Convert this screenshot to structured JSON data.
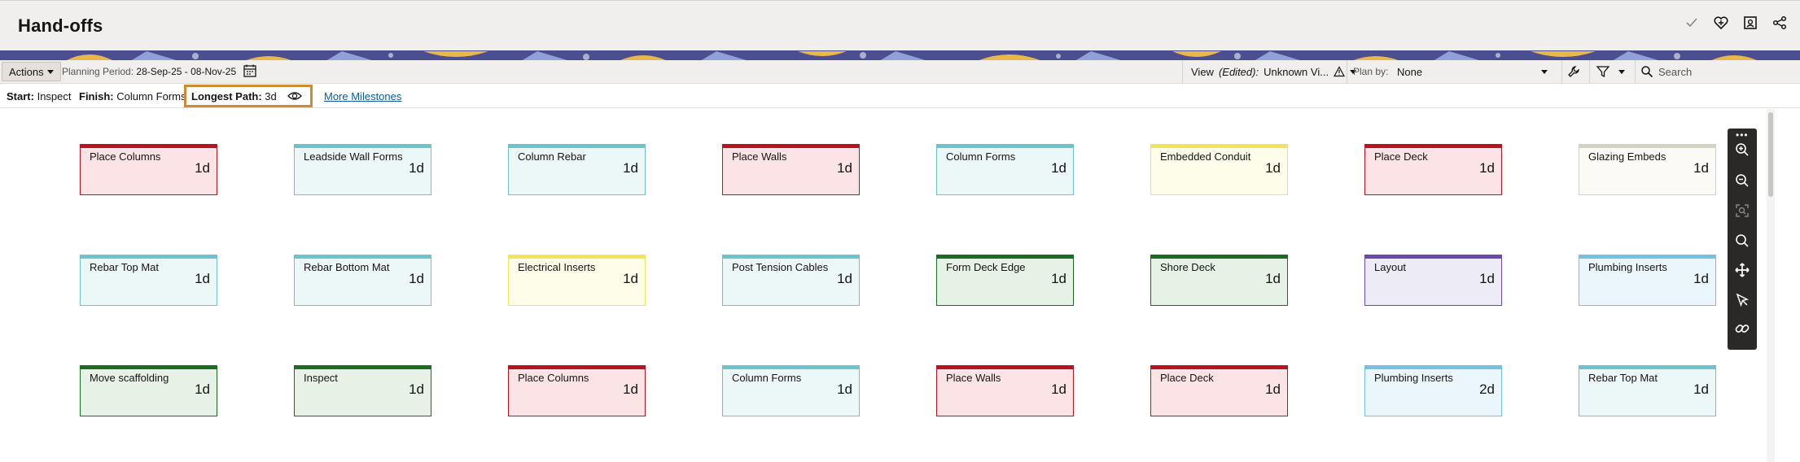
{
  "header": {
    "title": "Hand-offs",
    "icons": [
      "check-icon",
      "heart-plus-icon",
      "contact-card-icon",
      "share-icon"
    ]
  },
  "toolbar": {
    "actions_label": "Actions",
    "planning_label": "Planning Period:",
    "planning_value": "28-Sep-25 - 08-Nov-25",
    "view_label": "View",
    "view_edited": "(Edited):",
    "view_value": "Unknown Vi...",
    "planby_label": "Plan by:",
    "planby_value": "None",
    "search_placeholder": "Search"
  },
  "subbar": {
    "start_label": "Start:",
    "start_value": "Inspect",
    "finish_label": "Finish:",
    "finish_value": "Column Forms",
    "longest_label": "Longest Path:",
    "longest_value": "3d",
    "more_milestones": "More Milestones"
  },
  "rows": [
    [
      {
        "name": "Place Columns",
        "dur": "1d",
        "color": "red"
      },
      {
        "name": "Leadside Wall Forms",
        "dur": "1d",
        "color": "teal"
      },
      {
        "name": "Column Rebar",
        "dur": "1d",
        "color": "teal"
      },
      {
        "name": "Place Walls",
        "dur": "1d",
        "color": "red"
      },
      {
        "name": "Column Forms",
        "dur": "1d",
        "color": "teal"
      },
      {
        "name": "Embedded Conduit",
        "dur": "1d",
        "color": "yellow"
      },
      {
        "name": "Place Deck",
        "dur": "1d",
        "color": "red"
      },
      {
        "name": "Glazing Embeds",
        "dur": "1d",
        "color": "beige"
      }
    ],
    [
      {
        "name": "Rebar Top Mat",
        "dur": "1d",
        "color": "teal"
      },
      {
        "name": "Rebar Bottom Mat",
        "dur": "1d",
        "color": "teal"
      },
      {
        "name": "Electrical Inserts",
        "dur": "1d",
        "color": "yellow"
      },
      {
        "name": "Post Tension Cables",
        "dur": "1d",
        "color": "teal"
      },
      {
        "name": "Form Deck Edge",
        "dur": "1d",
        "color": "green"
      },
      {
        "name": "Shore Deck",
        "dur": "1d",
        "color": "green"
      },
      {
        "name": "Layout",
        "dur": "1d",
        "color": "purple"
      },
      {
        "name": "Plumbing Inserts",
        "dur": "1d",
        "color": "blue"
      }
    ],
    [
      {
        "name": "Move scaffolding",
        "dur": "1d",
        "color": "green"
      },
      {
        "name": "Inspect",
        "dur": "1d",
        "color": "green"
      },
      {
        "name": "Place Columns",
        "dur": "1d",
        "color": "red"
      },
      {
        "name": "Column Forms",
        "dur": "1d",
        "color": "teal"
      },
      {
        "name": "Place Walls",
        "dur": "1d",
        "color": "red"
      },
      {
        "name": "Place Deck",
        "dur": "1d",
        "color": "red"
      },
      {
        "name": "Plumbing Inserts",
        "dur": "2d",
        "color": "blue"
      },
      {
        "name": "Rebar Top Mat",
        "dur": "1d",
        "color": "teal"
      }
    ]
  ],
  "zoom_tools": [
    "zoom-in-icon",
    "zoom-out-icon",
    "fit-to-screen-icon",
    "search-icon",
    "pan-icon",
    "select-arrow-icon",
    "link-icon"
  ]
}
